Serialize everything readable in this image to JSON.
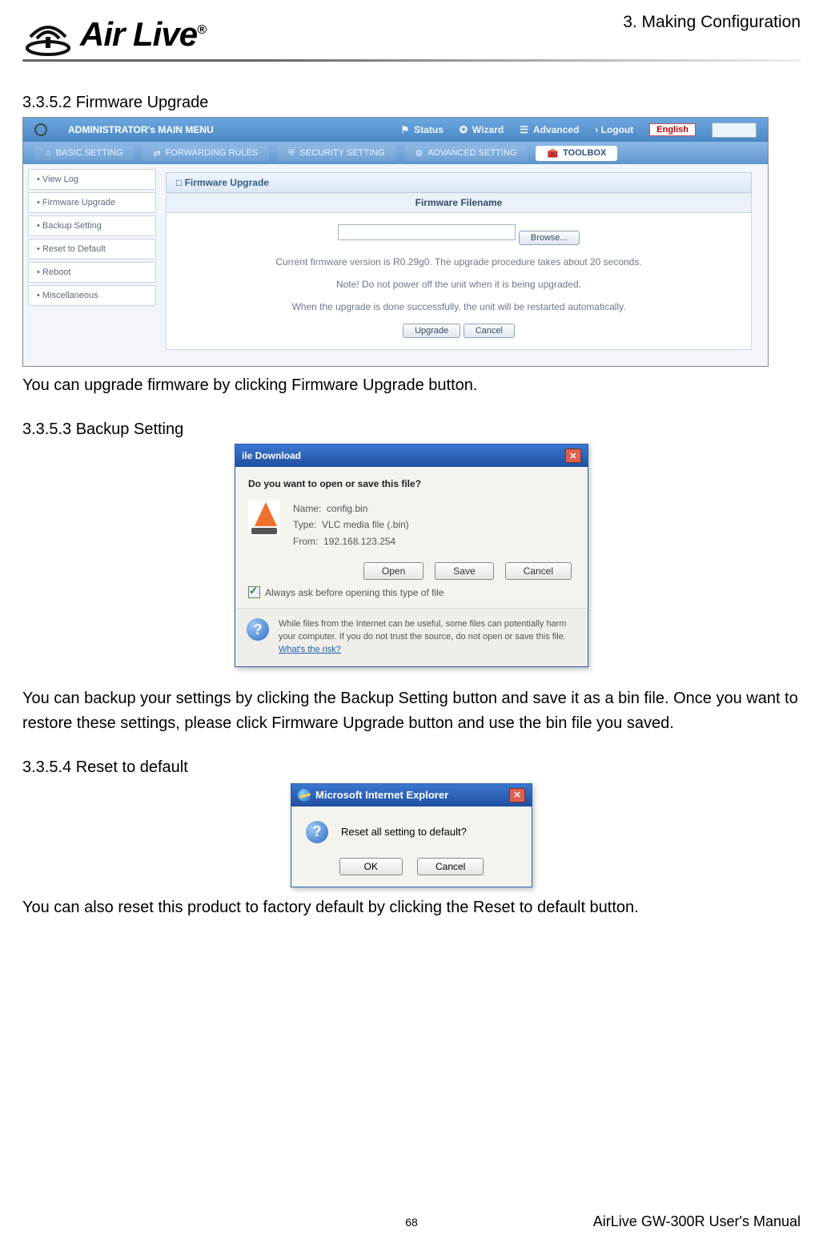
{
  "header": {
    "chapter": "3. Making Configuration",
    "logo_text": "Air Live",
    "logo_reg": "®"
  },
  "sec1": {
    "heading": "3.3.5.2 Firmware Upgrade",
    "after_text": "You can upgrade firmware by clicking Firmware Upgrade button."
  },
  "ss1": {
    "top": {
      "main": "ADMINISTRATOR's MAIN MENU",
      "status": "Status",
      "wizard": "Wizard",
      "advanced": "Advanced",
      "logout": "› Logout",
      "lang_label": "English"
    },
    "tabs": {
      "basic": "BASIC SETTING",
      "forwarding": "FORWARDING RULES",
      "security": "SECURITY SETTING",
      "adv": "ADVANCED SETTING",
      "toolbox": "TOOLBOX"
    },
    "side": {
      "i0": "View Log",
      "i1": "Firmware Upgrade",
      "i2": "Backup Setting",
      "i3": "Reset to Default",
      "i4": "Reboot",
      "i5": "Miscellaneous"
    },
    "panel": {
      "title": "Firmware Upgrade",
      "col": "Firmware Filename",
      "browse": "Browse...",
      "line1": "Current firmware version is R0.29g0. The upgrade procedure takes about 20 seconds.",
      "line2": "Note! Do not power off the unit when it is being upgraded.",
      "line3": "When the upgrade is done successfully, the unit will be restarted automatically.",
      "upgrade": "Upgrade",
      "cancel": "Cancel"
    }
  },
  "sec2": {
    "heading": "3.3.5.3 Backup Setting",
    "after_text": "You can backup your settings by clicking the Backup Setting button and save it as a bin file. Once you want to restore these settings, please click Firmware Upgrade button and use the bin file you saved."
  },
  "ss2": {
    "title": "ile Download",
    "question": "Do you want to open or save this file?",
    "name_lbl": "Name:",
    "name_val": "config.bin",
    "type_lbl": "Type:",
    "type_val": "VLC media file (.bin)",
    "from_lbl": "From:",
    "from_val": "192.168.123.254",
    "open": "Open",
    "save": "Save",
    "cancel": "Cancel",
    "always": "Always ask before opening this type of file",
    "foot1": "While files from the Internet can be useful, some files can potentially harm your computer. If you do not trust the source, do not open or save this file. ",
    "foot_link": "What's the risk?"
  },
  "sec3": {
    "heading": "3.3.5.4 Reset to default",
    "after_text": "You can also reset this product to factory default by clicking the Reset to default button."
  },
  "ss3": {
    "title": "Microsoft Internet Explorer",
    "msg": "Reset all setting to default?",
    "ok": "OK",
    "cancel": "Cancel"
  },
  "footer": {
    "page": "68",
    "right": "AirLive GW-300R User's Manual"
  }
}
